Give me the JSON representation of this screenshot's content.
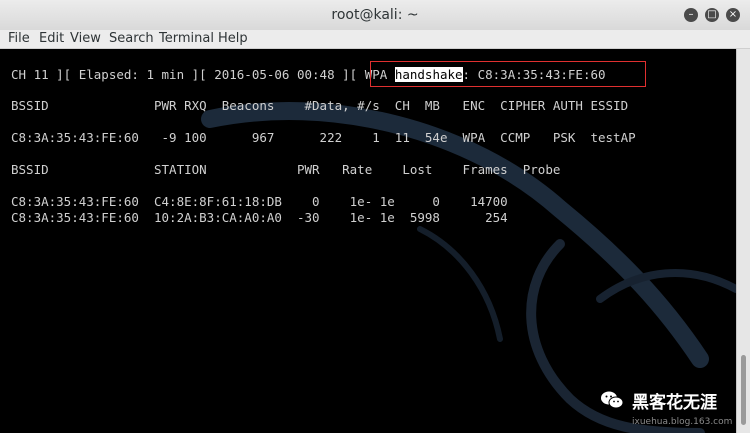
{
  "window": {
    "title": "root@kali: ~"
  },
  "menu": [
    "File",
    "Edit",
    "View",
    "Search",
    "Terminal",
    "Help"
  ],
  "terminal": {
    "status_pre": "CH 11 ][ Elapsed: 1 min ][ 2016-05-06 00:48 ][ WPA ",
    "status_hl": "handshake",
    "status_post": ": C8:3A:35:43:FE:60",
    "ap_header": "BSSID              PWR RXQ  Beacons    #Data, #/s  CH  MB   ENC  CIPHER AUTH ESSID",
    "ap_row": "C8:3A:35:43:FE:60   -9 100      967      222    1  11  54e  WPA  CCMP   PSK  testAP",
    "st_header": "BSSID              STATION            PWR   Rate    Lost    Frames  Probe",
    "st_row1": "C8:3A:35:43:FE:60  C4:8E:8F:61:18:DB    0    1e- 1e     0    14700",
    "st_row2": "C8:3A:35:43:FE:60  10:2A:B3:CA:A0:A0  -30    1e- 1e  5998      254"
  },
  "watermark": {
    "text": "黑客花无涯",
    "url": "ixuehua.blog.163.com"
  }
}
